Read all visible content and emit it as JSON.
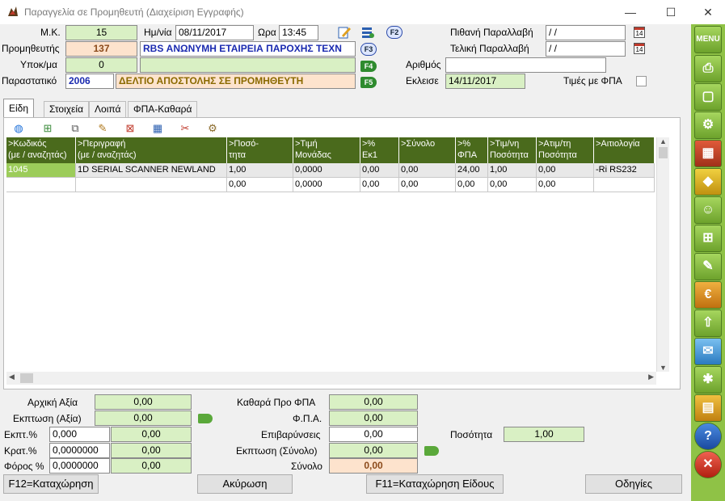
{
  "window": {
    "title": "Παραγγελία σε Προμηθευτή (Διαχείριση Εγγραφής)",
    "minimize": "—",
    "maximize": "☐",
    "close": "✕"
  },
  "header": {
    "mk_label": "Μ.Κ.",
    "mk_value": "15",
    "date_label": "Ημ/νία",
    "date_value": "08/11/2017",
    "time_label": "Ωρα",
    "time_value": "13:45",
    "supplier_label": "Προμηθευτής",
    "supplier_code": "137",
    "supplier_name": "RBS ΑΝΩΝΥΜΗ ΕΤΑΙΡΕΙΑ ΠΑΡΟΧΗΣ ΤΕΧΝ",
    "branch_label": "Υποκ/μα",
    "branch_value": "0",
    "branch_name": "",
    "doc_label": "Παραστατικό",
    "doc_code": "2006",
    "doc_name": "ΔΕΛΤΙΟ ΑΠΟΣΤΟΛΗΣ ΣΕ ΠΡΟΜΗΘΕΥΤΗ",
    "probable_label": "Πιθανή Παραλλαβή",
    "probable_value": "  /  /",
    "final_label": "Τελική Παραλλαβή",
    "final_value": "  /  /",
    "number_label": "Αριθμός",
    "number_value": "",
    "closed_label": "Εκλεισε",
    "closed_value": "14/11/2017",
    "vat_prices_label": "Τιμές με ΦΠΑ",
    "f2": "F2",
    "f3": "F3",
    "f4": "F4",
    "f5": "F5",
    "cal": "14"
  },
  "tabs": [
    {
      "label": "Είδη"
    },
    {
      "label": "Στοιχεία"
    },
    {
      "label": "Λοιπά"
    },
    {
      "label": "ΦΠΑ-Καθαρά"
    }
  ],
  "grid": {
    "columns": [
      {
        "l1": ">Κωδικός",
        "l2": "(με / αναζητάς)"
      },
      {
        "l1": ">Περιγραφή",
        "l2": "(με / αναζητάς)"
      },
      {
        "l1": ">Ποσό-",
        "l2": "τητα"
      },
      {
        "l1": ">Τιμή",
        "l2": "Μονάδας"
      },
      {
        "l1": ">%",
        "l2": "Εκ1"
      },
      {
        "l1": ">Σύνολο",
        "l2": ""
      },
      {
        "l1": ">%",
        "l2": "ΦΠΑ"
      },
      {
        "l1": ">Τιμ/νη",
        "l2": "Ποσότητα"
      },
      {
        "l1": ">Ατιμ/τη",
        "l2": "Ποσότητα"
      },
      {
        "l1": ">Αιτιολογία",
        "l2": ""
      }
    ],
    "rows": [
      [
        "1045",
        "1D SERIAL SCANNER NEWLAND",
        "1,00",
        "0,0000",
        "0,00",
        "0,00",
        "24,00",
        "1,00",
        "0,00",
        "-Ri RS232"
      ],
      [
        "",
        "",
        "0,00",
        "0,0000",
        "0,00",
        "0,00",
        "0,00",
        "0,00",
        "0,00",
        ""
      ]
    ]
  },
  "totals": {
    "initial_label": "Αρχική Αξία",
    "initial_value": "0,00",
    "discount_label": "Εκπτωση (Αξία)",
    "discount_value": "0,00",
    "disc_pct_label": "Εκπτ.%",
    "disc_pct_value": "0,000",
    "disc_pct_amount": "0,00",
    "ret_pct_label": "Κρατ.%",
    "ret_pct_value": "0,0000000",
    "ret_pct_amount": "0,00",
    "tax_pct_label": "Φόρος %",
    "tax_pct_value": "0,0000000",
    "tax_pct_amount": "0,00",
    "net_label": "Καθαρά Προ ΦΠΑ",
    "net_value": "0,00",
    "vat_label": "Φ.Π.Α.",
    "vat_value": "0,00",
    "charges_label": "Επιβαρύνσεις",
    "charges_value": "0,00",
    "disc_total_label": "Εκπτωση (Σύνολο)",
    "disc_total_value": "0,00",
    "total_label": "Σύνολο",
    "total_value": "0,00",
    "qty_label": "Ποσότητα",
    "qty_value": "1,00"
  },
  "buttons": {
    "save": "F12=Καταχώρηση",
    "cancel": "Ακύρωση",
    "save_item": "F11=Καταχώρηση Είδους",
    "help": "Οδηγίες"
  },
  "sidebar": {
    "menu": "MENU"
  }
}
